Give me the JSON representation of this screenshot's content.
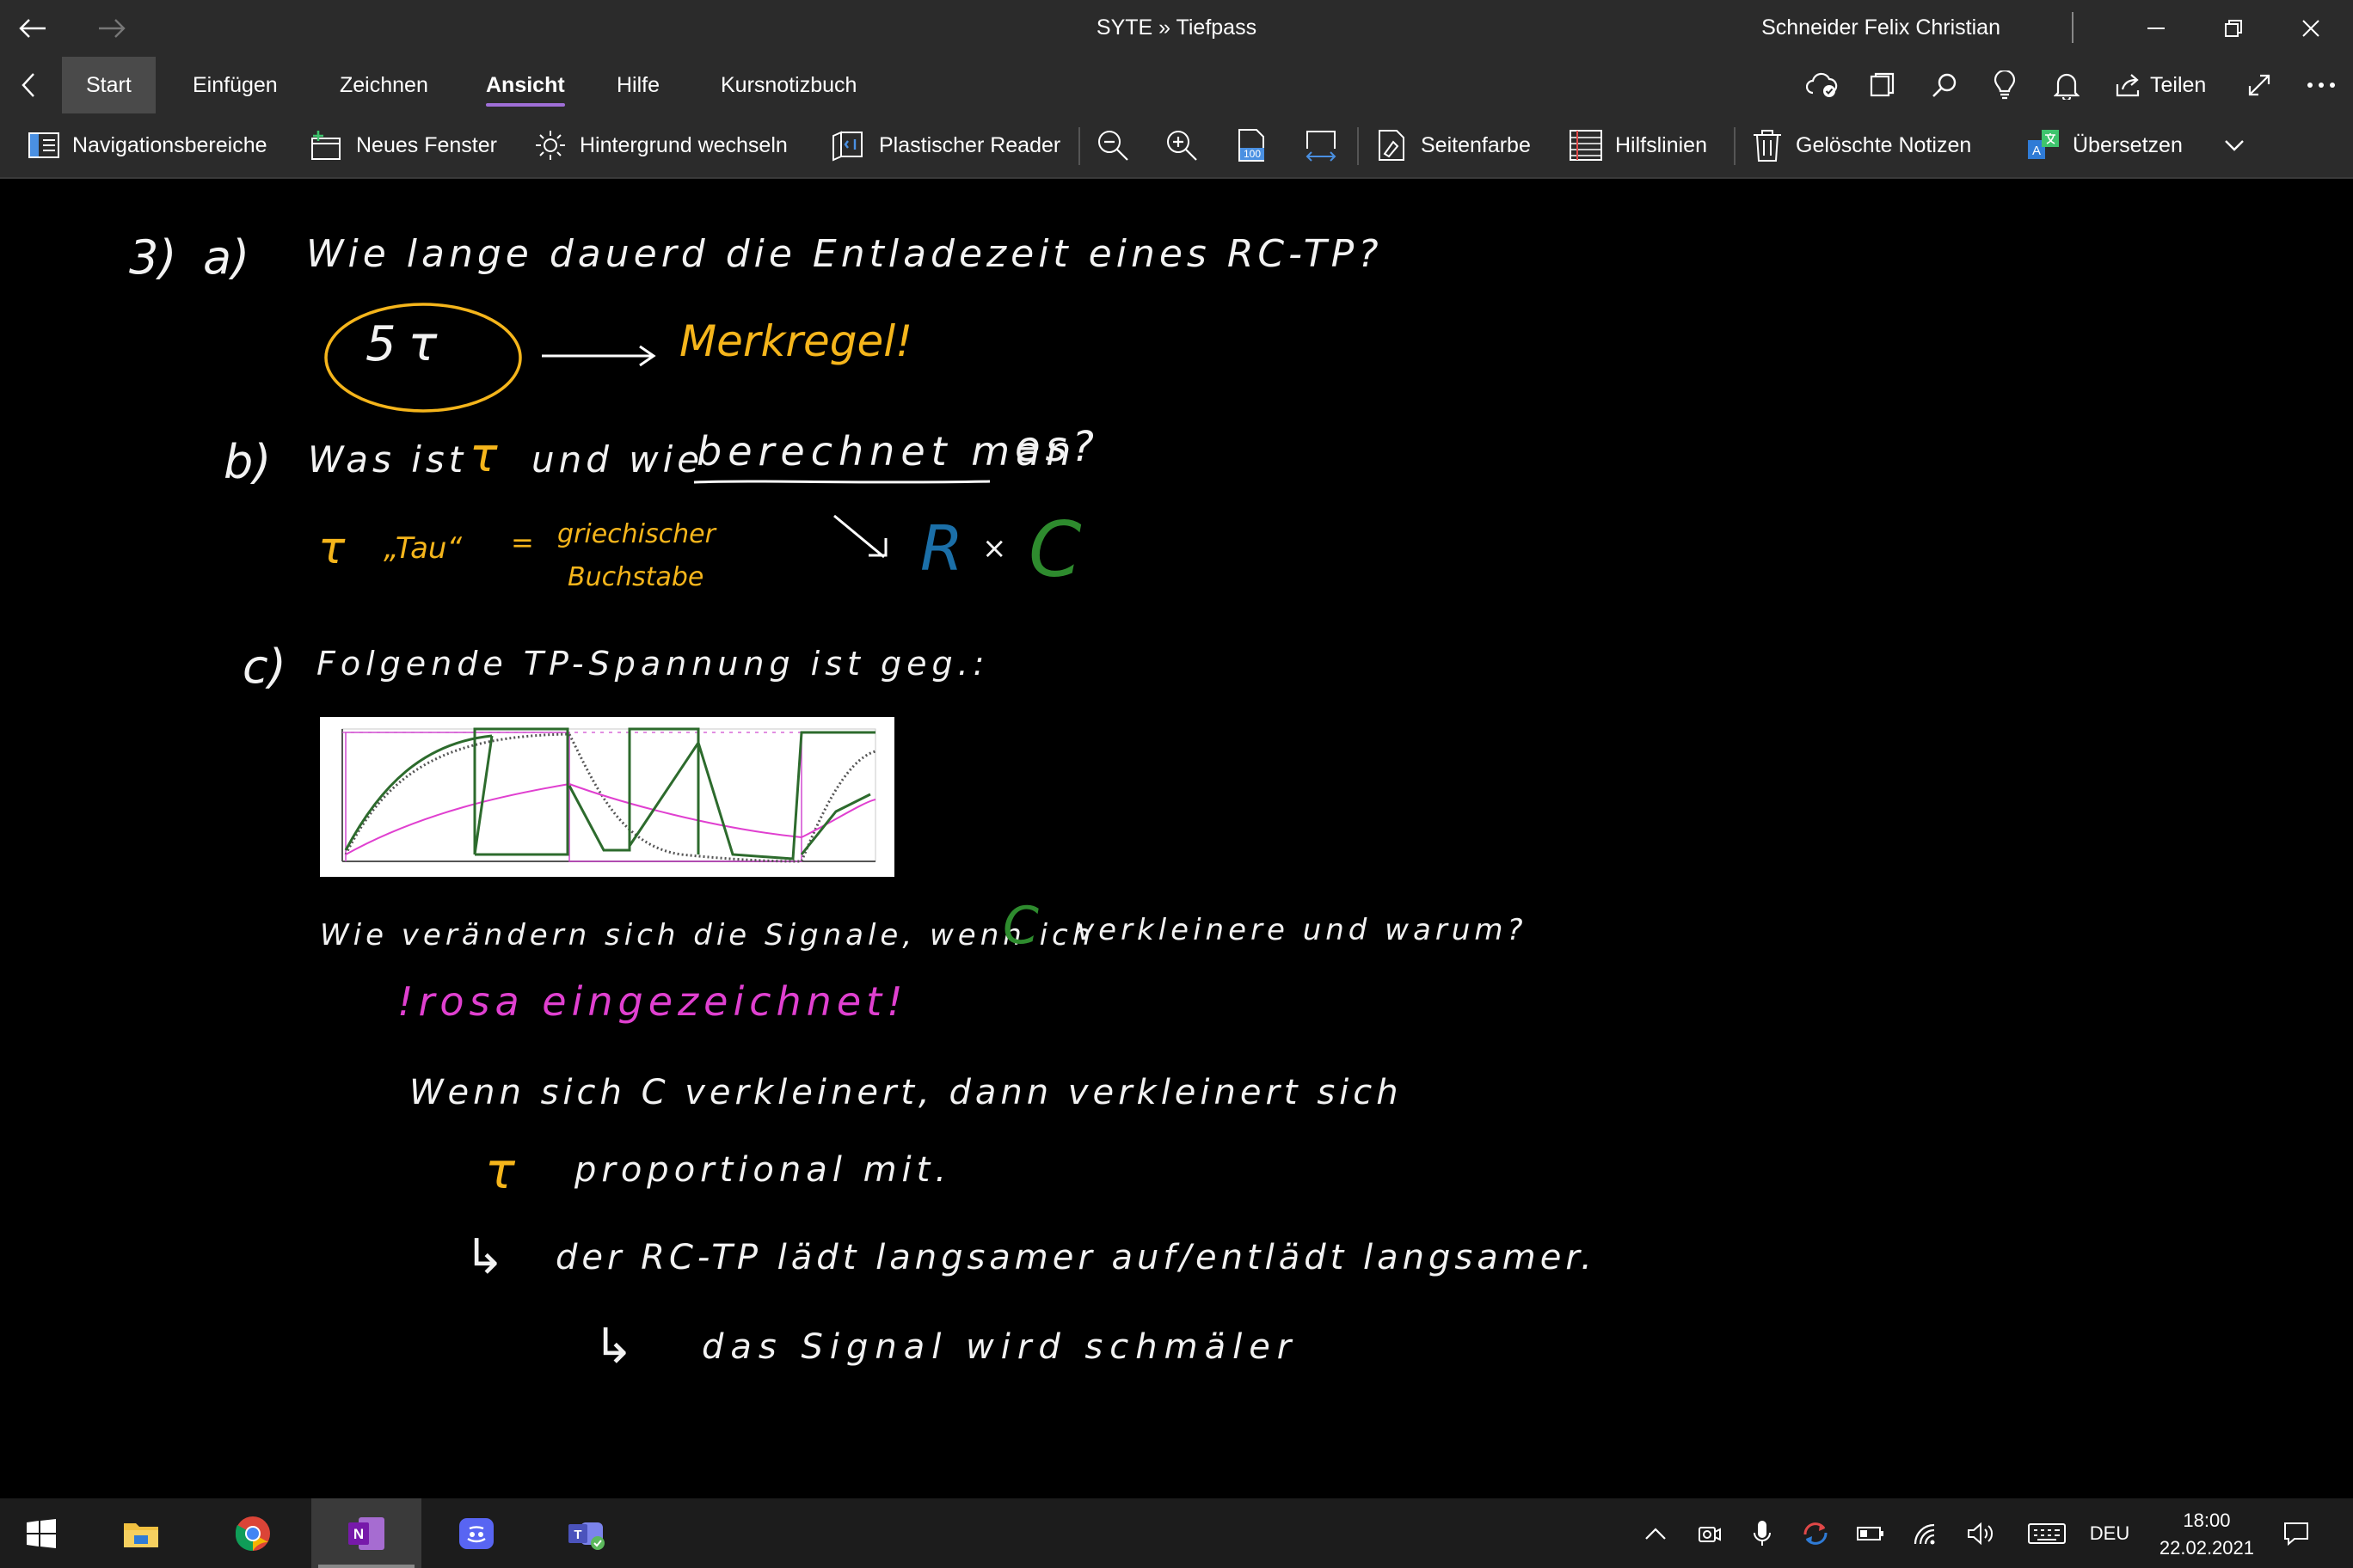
{
  "window": {
    "title": "SYTE » Tiefpass",
    "user": "Schneider Felix Christian"
  },
  "ribbon": {
    "tabs": [
      "Start",
      "Einfügen",
      "Zeichnen",
      "Ansicht",
      "Hilfe",
      "Kursnotizbuch"
    ],
    "active_tab": "Ansicht",
    "share_label": "Teilen"
  },
  "toolbar": {
    "navigationsbereiche": "Navigationsbereiche",
    "neues_fenster": "Neues Fenster",
    "hintergrund": "Hintergrund wechseln",
    "reader": "Plastischer Reader",
    "zoom_badge": "100",
    "seitenfarbe": "Seitenfarbe",
    "hilfslinien": "Hilfslinien",
    "geloeschte": "Gelöschte Notizen",
    "uebersetzen": "Übersetzen"
  },
  "notes": {
    "q3_number": "3)",
    "q3a_label": "a)",
    "q3a_question": "Wie lange dauerd die Entladezeit eines RC-TP?",
    "q3a_answer": "5τ",
    "q3a_hint": "Merkregel!",
    "q3b_label": "b)",
    "q3b_question_start": "Was ist",
    "q3b_tau": "τ",
    "q3b_question_mid": "und wie",
    "q3b_question_underlined": "berechnet man",
    "q3b_question_end": "es?",
    "tau_symbol": "τ",
    "tau_name": "„Tau“",
    "equals": "=",
    "tau_desc_1": "griechischer",
    "tau_desc_2": "Buchstabe",
    "formula_r": "R",
    "formula_x": "×",
    "formula_c": "C",
    "q3c_label": "c)",
    "q3c_statement": "Folgende TP-Spannung ist geg.:",
    "q3c_question_a": "Wie verändern sich die Signale, wenn ich",
    "q3c_question_c": "C",
    "q3c_question_b": "verkleinere und warum?",
    "pink_note": "!rosa eingezeichnet!",
    "answer_line1": "Wenn sich C verkleinert, dann verkleinert sich",
    "answer_line2_tau": "τ",
    "answer_line2": "proportional mit.",
    "answer_line3_arrow": "↳",
    "answer_line3": "der RC-TP lädt langsamer auf/entlädt langsamer.",
    "answer_line4_arrow": "↳",
    "answer_line4": "das Signal wird schmäler"
  },
  "taskbar": {
    "apps": [
      "start-menu",
      "file-explorer",
      "chrome",
      "onenote",
      "discord",
      "teams"
    ],
    "language": "DEU",
    "time": "18:00",
    "date": "22.02.2021"
  }
}
